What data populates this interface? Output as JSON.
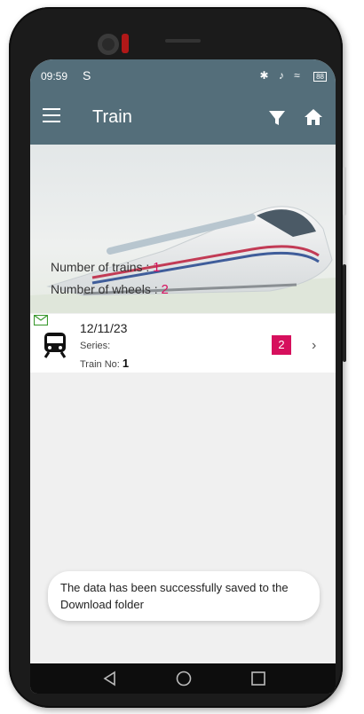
{
  "status_bar": {
    "time": "09:59",
    "sim_glyph": "S",
    "right_glyphs": "✱ ♪ ≈",
    "battery": "88"
  },
  "app_bar": {
    "title": "Train",
    "icons": [
      "menu-icon",
      "filter-icon",
      "home-icon"
    ]
  },
  "summary": {
    "trains_label": "Number of trains",
    "trains_value": "1",
    "wheels_label": "Number of wheels",
    "wheels_value": "2",
    "separator": ":"
  },
  "list": [
    {
      "date": "12/11/23",
      "series_label": "Series:",
      "train_no_label": "Train No:",
      "train_no_value": "1",
      "badge": "2",
      "chevron": "›"
    }
  ],
  "toast": {
    "message": "The data has been successfully saved to the Download folder"
  },
  "colors": {
    "app_bar": "#546e7a",
    "accent": "#d6105d",
    "mail_icon": "#3d9a32"
  }
}
